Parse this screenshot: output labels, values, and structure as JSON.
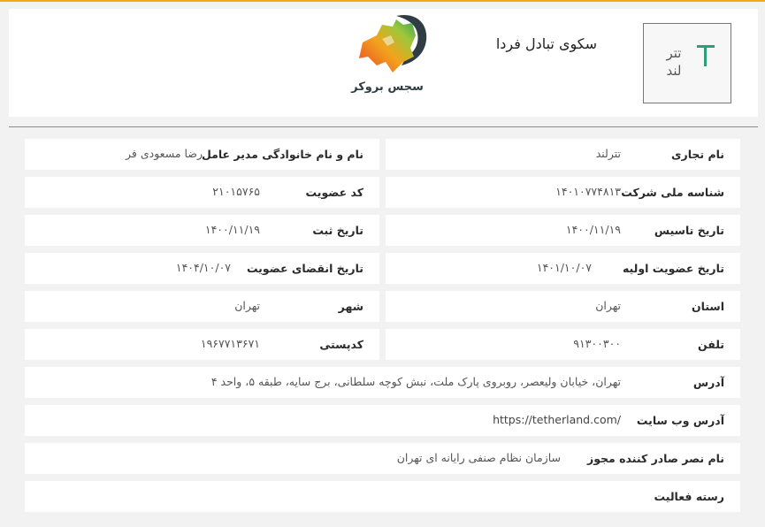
{
  "header": {
    "title": "سکوی تبادل فردا",
    "company_logo_text_top": "تتر",
    "company_logo_text_bottom": "لند",
    "broker_logo_text": "سجس بروکر"
  },
  "colors": {
    "accent": "#f0a818",
    "logo_green": "#2f9c7a"
  },
  "rows": {
    "trade_name": {
      "label": "نام تجاری",
      "value": "تترلند"
    },
    "ceo": {
      "label": "نام و نام خانوادگی مدیر عامل",
      "value": "رضا مسعودی فر"
    },
    "national_id": {
      "label": "شناسه ملی شرکت",
      "value": "۱۴۰۱۰۷۷۴۸۱۳"
    },
    "member_code": {
      "label": "کد عضویت",
      "value": "۲۱۰۱۵۷۶۵"
    },
    "founded": {
      "label": "تاریخ تاسیس",
      "value": "۱۴۰۰/۱۱/۱۹"
    },
    "registered": {
      "label": "تاریخ ثبت",
      "value": "۱۴۰۰/۱۱/۱۹"
    },
    "initial_membership": {
      "label": "تاریخ عضویت اولیه",
      "value": "۱۴۰۱/۱۰/۰۷"
    },
    "membership_expiry": {
      "label": "تاریخ انقضای عضویت",
      "value": "۱۴۰۴/۱۰/۰۷"
    },
    "province": {
      "label": "استان",
      "value": "تهران"
    },
    "city": {
      "label": "شهر",
      "value": "تهران"
    },
    "phone": {
      "label": "تلفن",
      "value": "۹۱۳۰۰۳۰۰"
    },
    "postal_code": {
      "label": "کدپستی",
      "value": "۱۹۶۷۷۱۳۶۷۱"
    },
    "address": {
      "label": "آدرس",
      "value": "تهران، خیابان ولیعصر، روبروی پارک ملت، نبش کوچه سلطانی، برج سایه، طبقه ۵، واحد ۴"
    },
    "website": {
      "label": "آدرس وب سایت",
      "value": "https://tetherland.com/"
    },
    "license_issuer": {
      "label": "نام نصر صادر کننده مجوز",
      "value": "سازمان نظام صنفی رایانه ای تهران"
    },
    "activity": {
      "label": "رسته فعالیت",
      "value": ""
    }
  }
}
